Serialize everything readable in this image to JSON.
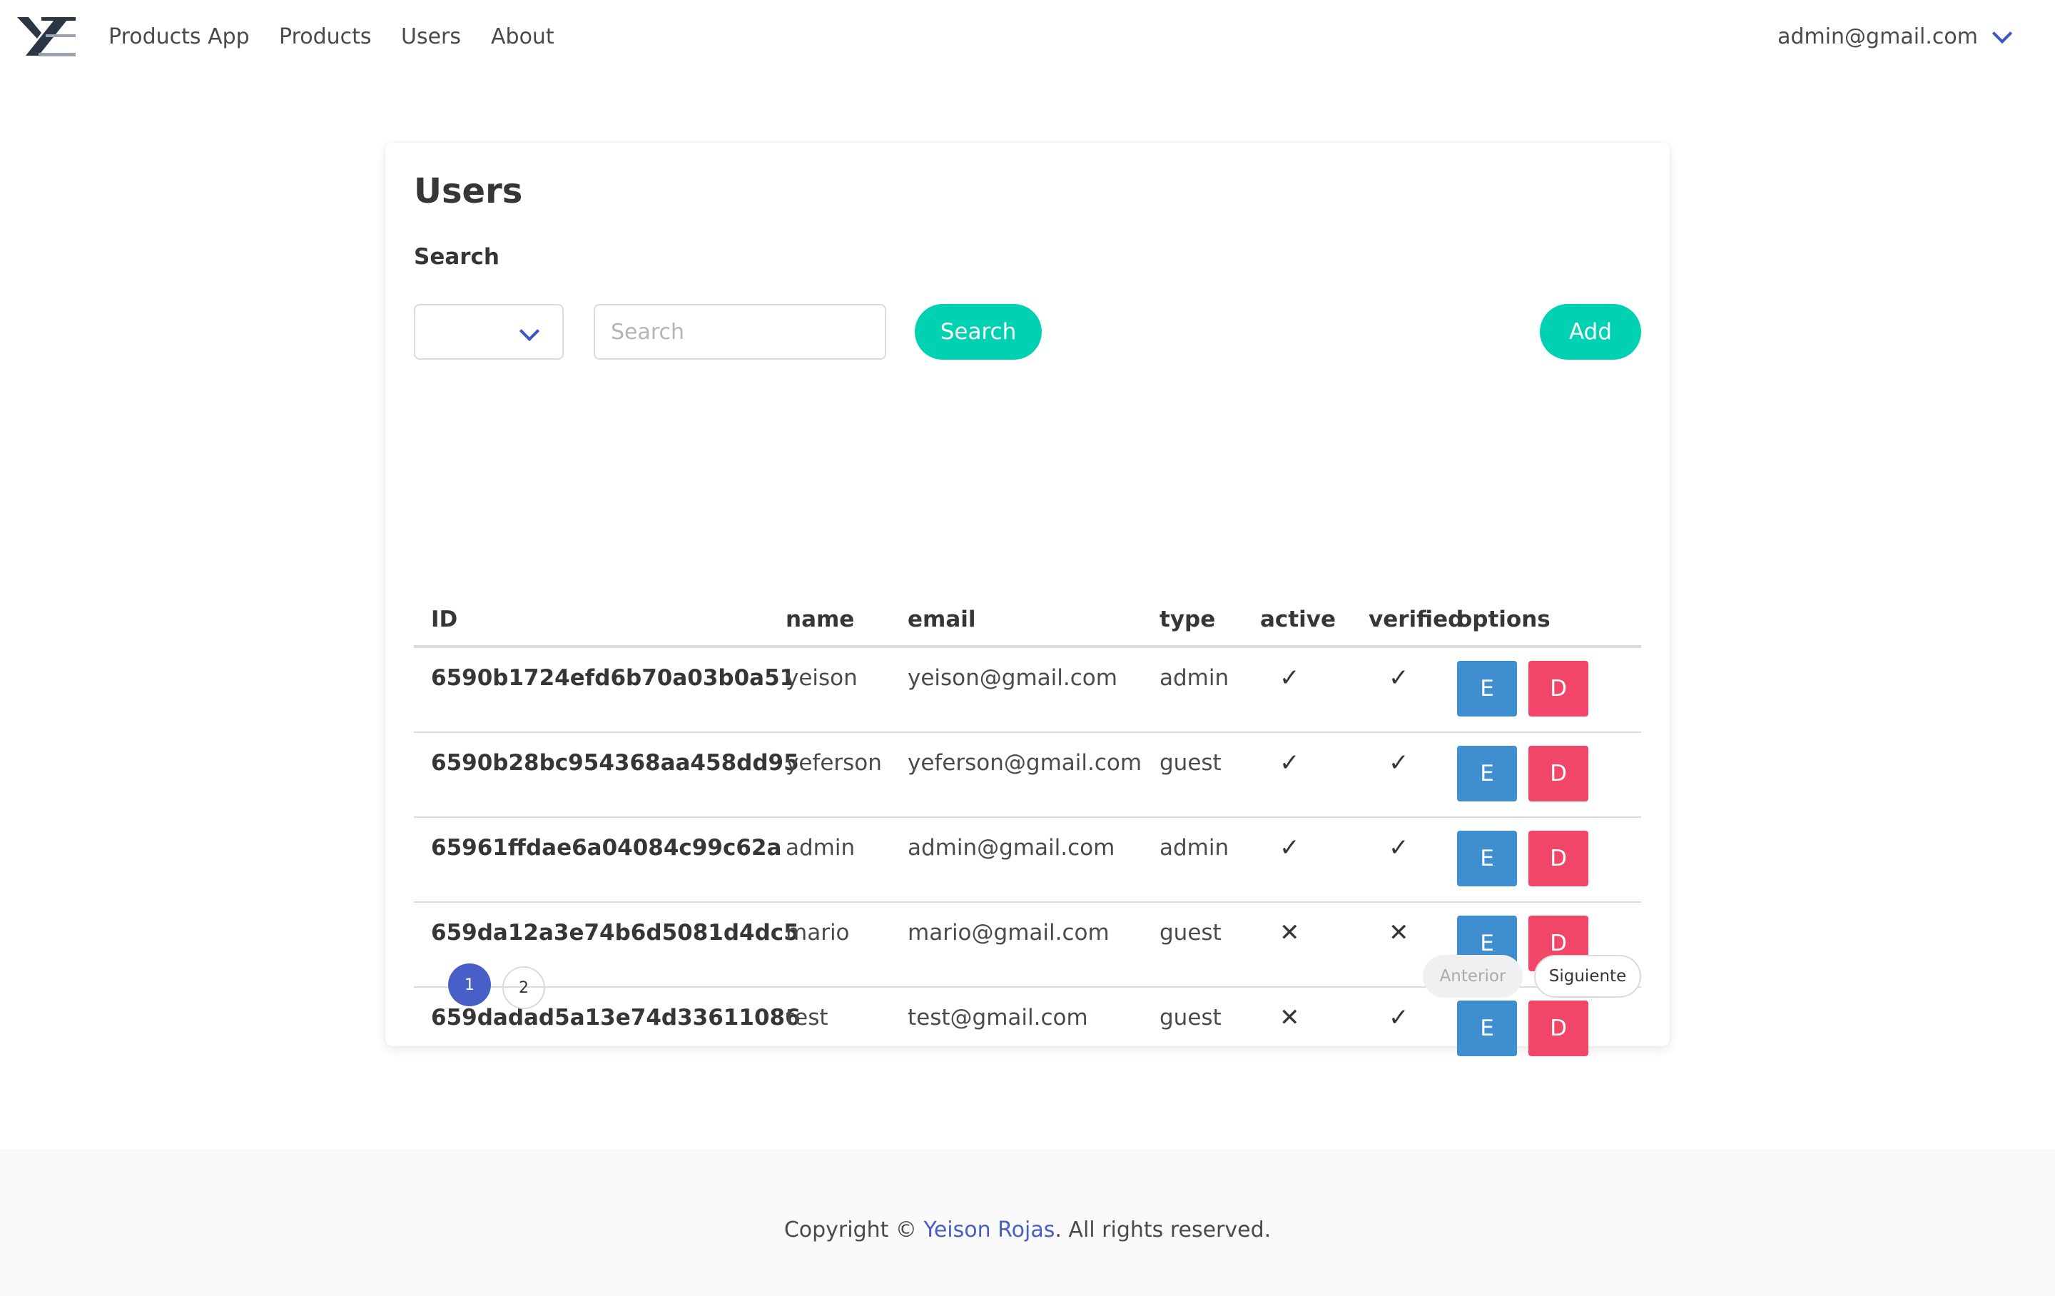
{
  "navbar": {
    "brand": "Products App",
    "links": [
      "Products",
      "Users",
      "About"
    ],
    "user_email": "admin@gmail.com",
    "logo_icon": "brand-logo-icon"
  },
  "page": {
    "title": "Users",
    "search_label": "Search",
    "select_value": "",
    "search_placeholder": "Search",
    "search_button": "Search",
    "add_button": "Add"
  },
  "table": {
    "headers": [
      "ID",
      "name",
      "email",
      "type",
      "active",
      "verified",
      "options"
    ],
    "rows": [
      {
        "id": "6590b1724efd6b70a03b0a51",
        "name": "yeison",
        "email": "yeison@gmail.com",
        "type": "admin",
        "active": "✓",
        "verified": "✓",
        "edit": "E",
        "delete": "D"
      },
      {
        "id": "6590b28bc954368aa458dd95",
        "name": "yeferson",
        "email": "yeferson@gmail.com",
        "type": "guest",
        "active": "✓",
        "verified": "✓",
        "edit": "E",
        "delete": "D"
      },
      {
        "id": "65961ffdae6a04084c99c62a",
        "name": "admin",
        "email": "admin@gmail.com",
        "type": "admin",
        "active": "✓",
        "verified": "✓",
        "edit": "E",
        "delete": "D"
      },
      {
        "id": "659da12a3e74b6d5081d4dc5",
        "name": "mario",
        "email": "mario@gmail.com",
        "type": "guest",
        "active": "✕",
        "verified": "✕",
        "edit": "E",
        "delete": "D"
      },
      {
        "id": "659dadad5a13e74d33611086",
        "name": "test",
        "email": "test@gmail.com",
        "type": "guest",
        "active": "✕",
        "verified": "✓",
        "edit": "E",
        "delete": "D"
      }
    ]
  },
  "pagination": {
    "pages": [
      "1",
      "2"
    ],
    "current": "1",
    "prev": "Anterior",
    "next": "Siguiente"
  },
  "footer": {
    "prefix": "Copyright © ",
    "author": "Yeison Rojas",
    "suffix": ". All rights reserved."
  },
  "colors": {
    "primary": "#00d1b2",
    "link": "#485fc7",
    "info": "#3e8ed0",
    "danger": "#f14668"
  }
}
